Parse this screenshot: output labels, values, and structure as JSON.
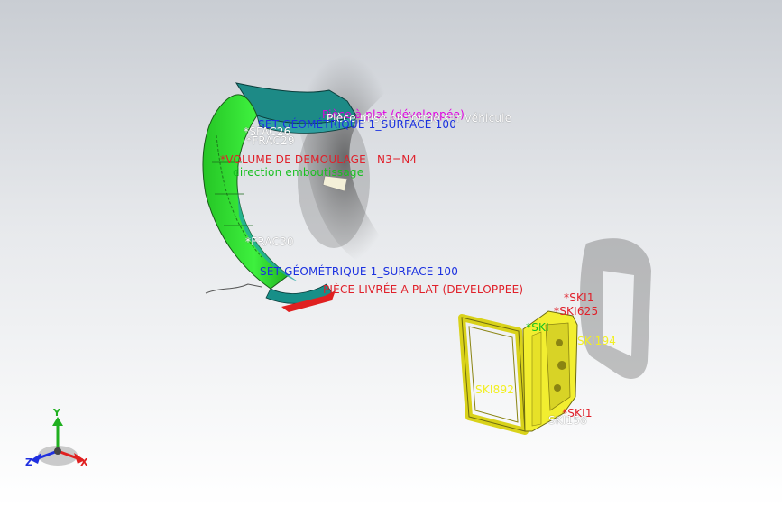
{
  "annotations": {
    "piece_mise_en_forme": "Pièce mise en forme sur véhicule",
    "piece_a_plat_magenta": "Pièce à plat (développée)",
    "set_geometrique_top": "SET GÉOMÉTRIQUE 1_SURFACE 100",
    "sfac26": "*SFAC26",
    "frac_top": "*FRAC29",
    "volume_demoulage": "*VOLUME DE DEMOULAGE",
    "n3_n4": "N3=N4",
    "direction_emboutissage": "direction emboutissage",
    "frac_mid": "*FRAC30",
    "set_geometrique_bottom": "SET GÉOMÉTRIQUE 1_SURFACE 100",
    "piece_livree": "PIÈCE LIVRÉE A PLAT (DEVELOPPEE)",
    "ski1_top": "*SKI1",
    "ski625": "*SKI625",
    "ski194": "SKI194",
    "ski892": "SKI892",
    "ski1_bottom": "*SKI1",
    "ski158": "SKI158",
    "ski_green": "*SKI"
  },
  "triad": {
    "x": "X",
    "y": "Y",
    "z": "Z"
  },
  "colors": {
    "part_green": "#2ee02e",
    "part_teal": "#1d8a86",
    "part_yellow": "#f2ee30",
    "flange_red": "#e02020",
    "annotation_red": "#e0202a",
    "annotation_blue": "#1a30e0",
    "background_top": "#c9cdd3",
    "background_bottom": "#ffffff"
  }
}
